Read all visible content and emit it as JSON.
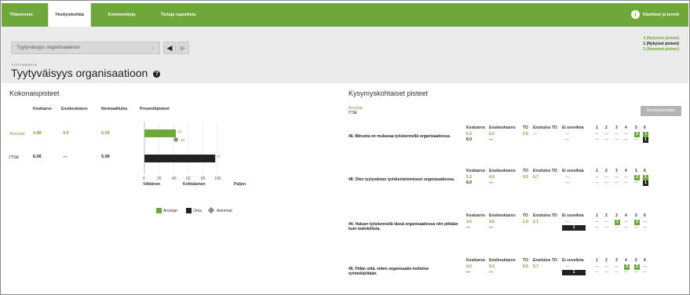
{
  "tabs": [
    "Yhteenveto",
    "Yksityiskohtia",
    "Kommentteja",
    "Tietoja raportista"
  ],
  "help_label": "Käsitteet ja termit",
  "selector": {
    "value": "Tyytyväisyys organisaatioon"
  },
  "breadcrumb": "TYYTYVÄISYYS",
  "page_title": "Tyytyväisyys organisaatioon",
  "legend_top": [
    "4 (Nykyiset pisteet)",
    "1 (Nykyiset pisteet)",
    "3 (Aiemmat pisteet)"
  ],
  "colors": {
    "green": "#6fa83a",
    "dark": "#222222",
    "diamond": "#8c8c8c"
  },
  "left": {
    "title": "Kokonaispisteet",
    "headers": [
      "Keskiarvo",
      "Ensikeskiarvo",
      "Normaalitulos",
      "Prosenttipisteet"
    ],
    "rows": [
      {
        "label": "Arvioijat",
        "keskiarvo": "4.88",
        "ensikeskiarvo": "4.9",
        "normaalitulos": "5.05"
      },
      {
        "label": "ITSE",
        "keskiarvo": "6.00",
        "ensikeskiarvo": "---",
        "normaalitulos": "5.06"
      }
    ],
    "axis_labels": [
      "Vähäinen",
      "Kohtalainen",
      "Paljon"
    ],
    "legend": [
      "Arvioijat",
      "Oma",
      "Aiemmat"
    ]
  },
  "chart_data": {
    "type": "bar",
    "categories": [
      "Arvioijat",
      "ITSE"
    ],
    "series": [
      {
        "name": "Arvioijat",
        "values": [
          43,
          null
        ]
      },
      {
        "name": "Oma",
        "values": [
          null,
          97
        ]
      },
      {
        "name": "Aiemmat",
        "values": [
          43,
          null
        ]
      }
    ],
    "bar_labels": [
      "43",
      "97"
    ],
    "diamond_label": "43",
    "xticks": [
      "0",
      "20",
      "40",
      "60",
      "80",
      "100"
    ],
    "xlim": [
      0,
      100
    ]
  },
  "right": {
    "title": "Kysymyskohtaiset pisteet",
    "rater_label": "Arvioijat",
    "self_label": "ITSE",
    "button_label": "Arvioijatasoittain",
    "headers": [
      "Keskiarvo",
      "Ensikeskiarvo",
      "TO",
      "Ensitulos TO",
      "Ei sovelleta",
      "1",
      "2",
      "3",
      "4",
      "5",
      "6"
    ],
    "questions": [
      {
        "text": "46. Minusta on mukavaa työskennellä organisaatiossa.",
        "rows": [
          {
            "keskiarvo": "5.3",
            "ensikeskiarvo": "5.0",
            "to": "0.5",
            "ensitulos_to": "---",
            "ei": "---",
            "d": [
              "---",
              "---",
              "---",
              "---",
              "3",
              "1"
            ]
          },
          {
            "keskiarvo": "6.0",
            "ensikeskiarvo": "---",
            "to": "",
            "ensitulos_to": "",
            "ei": "---",
            "d": [
              "---",
              "---",
              "---",
              "---",
              "---",
              "1"
            ]
          }
        ]
      },
      {
        "text": "48. Olen tyytyväinen työskentelemiseen organisaatiossa.",
        "rows": [
          {
            "keskiarvo": "5.3",
            "ensikeskiarvo": "4.5",
            "to": "0.5",
            "ensitulos_to": "0.7",
            "ei": "---",
            "d": [
              "---",
              "---",
              "---",
              "---",
              "3",
              "1"
            ]
          },
          {
            "keskiarvo": "6.0",
            "ensikeskiarvo": "---",
            "to": "",
            "ensitulos_to": "",
            "ei": "---",
            "d": [
              "---",
              "---",
              "---",
              "---",
              "---",
              "1"
            ]
          }
        ]
      },
      {
        "text": "44. Haluan työskennellä tässä organisaatiossa niin pitkään kuin mahdollista.",
        "rows": [
          {
            "keskiarvo": "4.5",
            "ensikeskiarvo": "4.5",
            "to": "1.0",
            "ensitulos_to": "2.1",
            "ei": "---",
            "d": [
              "---",
              "---",
              "1",
              "---",
              "3",
              "---"
            ]
          },
          {
            "keskiarvo": "---",
            "ensikeskiarvo": "---",
            "to": "",
            "ensitulos_to": "",
            "ei": "1",
            "d": [
              "---",
              "---",
              "---",
              "---",
              "---",
              "---"
            ]
          }
        ]
      },
      {
        "text": "45. Pidän siitä, miten organisaatio kohtelee työntekijöitään.",
        "rows": [
          {
            "keskiarvo": "4.5",
            "ensikeskiarvo": "5.5",
            "to": "0.6",
            "ensitulos_to": "0.7",
            "ei": "---",
            "d": [
              "---",
              "---",
              "---",
              "3",
              "2",
              "---"
            ]
          },
          {
            "keskiarvo": "---",
            "ensikeskiarvo": "---",
            "to": "",
            "ensitulos_to": "",
            "ei": "1",
            "d": [
              "---",
              "---",
              "---",
              "---",
              "---",
              "---"
            ]
          }
        ]
      }
    ]
  }
}
